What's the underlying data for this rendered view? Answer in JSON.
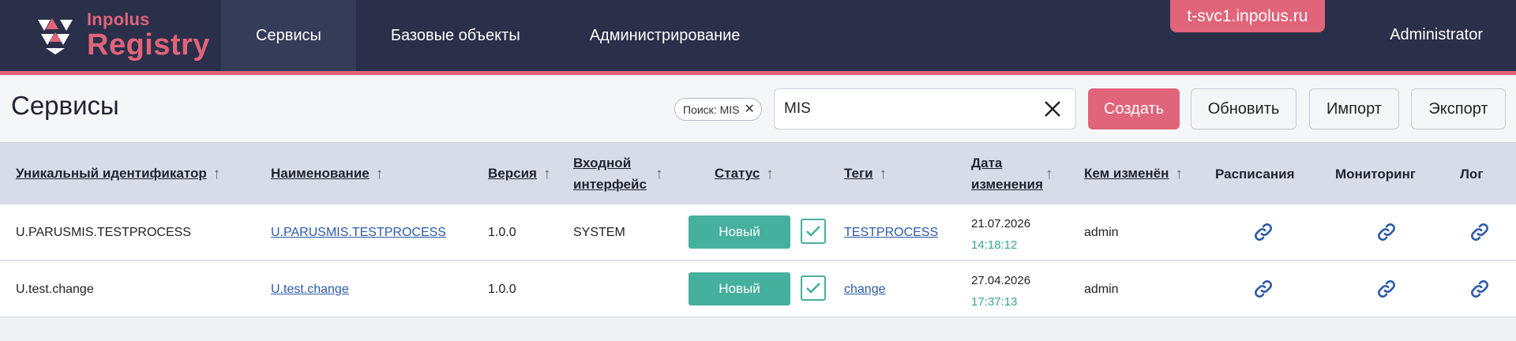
{
  "header": {
    "logo_small": "Inpolus",
    "logo_big": "Registry",
    "nav": [
      {
        "label": "Сервисы",
        "active": true
      },
      {
        "label": "Базовые объекты",
        "active": false
      },
      {
        "label": "Администрирование",
        "active": false
      }
    ],
    "env": "t-svc1.inpolus.ru",
    "user": "Administrator"
  },
  "toolbar": {
    "title": "Сервисы",
    "filter_chip": "Поиск: MIS",
    "search_value": "MIS",
    "create_label": "Создать",
    "refresh_label": "Обновить",
    "import_label": "Импорт",
    "export_label": "Экспорт"
  },
  "table": {
    "columns": [
      {
        "label": "Уникальный идентификатор",
        "sortable": true
      },
      {
        "label": "Наименование",
        "sortable": true
      },
      {
        "label": "Версия",
        "sortable": true
      },
      {
        "label": "Входной интерфейс",
        "sortable": true
      },
      {
        "label": "Статус",
        "sortable": true
      },
      {
        "label": "Теги",
        "sortable": true
      },
      {
        "label": "Дата изменения",
        "sortable": true
      },
      {
        "label": "Кем изменён",
        "sortable": true
      },
      {
        "label": "Расписания",
        "sortable": false
      },
      {
        "label": "Мониторинг",
        "sortable": false
      },
      {
        "label": "Лог",
        "sortable": false
      }
    ],
    "rows": [
      {
        "id": "U.PARUSMIS.TESTPROCESS",
        "name": "U.PARUSMIS.TESTPROCESS",
        "version": "1.0.0",
        "interface": "SYSTEM",
        "status": "Новый",
        "tag": "TESTPROCESS",
        "date": "21.07.2026",
        "time": "14:18:12",
        "changed_by": "admin"
      },
      {
        "id": "U.test.change",
        "name": "U.test.change",
        "version": "1.0.0",
        "interface": "",
        "status": "Новый",
        "tag": "change",
        "date": "27.04.2026",
        "time": "17:37:13",
        "changed_by": "admin"
      }
    ]
  },
  "colors": {
    "header_bg": "#2a3049",
    "accent": "#e0647a",
    "status_new": "#46b09e",
    "link": "#2d5aa8"
  }
}
